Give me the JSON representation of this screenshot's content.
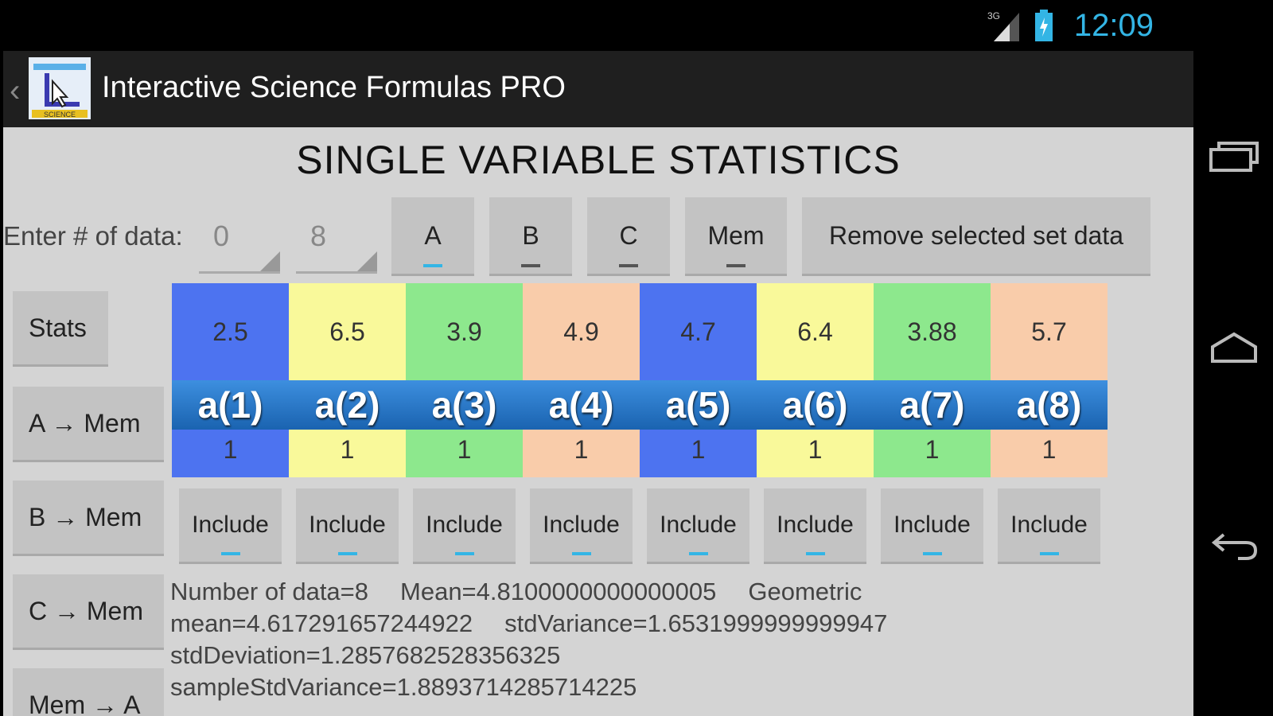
{
  "status": {
    "time": "12:09",
    "network": "3G"
  },
  "app": {
    "title": "Interactive Science Formulas PRO",
    "icon_text": "SCIENCE"
  },
  "page": {
    "title": "SINGLE VARIABLE STATISTICS"
  },
  "entry": {
    "label": "Enter # of data:",
    "field1": "0",
    "field2": "8"
  },
  "sets": [
    {
      "label": "A",
      "active": true
    },
    {
      "label": "B",
      "active": false
    },
    {
      "label": "C",
      "active": false
    },
    {
      "label": "Mem",
      "active": false
    }
  ],
  "remove_label": "Remove selected set data",
  "left_buttons": [
    "Stats",
    "A → Mem",
    "B → Mem",
    "C → Mem",
    "Mem → A"
  ],
  "data": [
    {
      "value": "2.5",
      "label": "a(1)",
      "mult": "1",
      "color": "#4d73f0"
    },
    {
      "value": "6.5",
      "label": "a(2)",
      "mult": "1",
      "color": "#f9f99a"
    },
    {
      "value": "3.9",
      "label": "a(3)",
      "mult": "1",
      "color": "#8de88d"
    },
    {
      "value": "4.9",
      "label": "a(4)",
      "mult": "1",
      "color": "#f9ccaa"
    },
    {
      "value": "4.7",
      "label": "a(5)",
      "mult": "1",
      "color": "#4d73f0"
    },
    {
      "value": "6.4",
      "label": "a(6)",
      "mult": "1",
      "color": "#f9f99a"
    },
    {
      "value": "3.88",
      "label": "a(7)",
      "mult": "1",
      "color": "#8de88d"
    },
    {
      "value": "5.7",
      "label": "a(8)",
      "mult": "1",
      "color": "#f9ccaa"
    }
  ],
  "include_label": "Include",
  "stats": {
    "count": "Number of data=8",
    "mean": "Mean=4.8100000000000005",
    "geo_mean": "Geometric mean=4.617291657244922",
    "std_variance": "stdVariance=1.6531999999999947",
    "std_deviation": "stdDeviation=1.2857682528356325",
    "sample_std_variance": "sampleStdVariance=1.8893714285714225"
  },
  "colors": {
    "accent": "#33b5e5",
    "label_band": "#2a7ad0"
  }
}
